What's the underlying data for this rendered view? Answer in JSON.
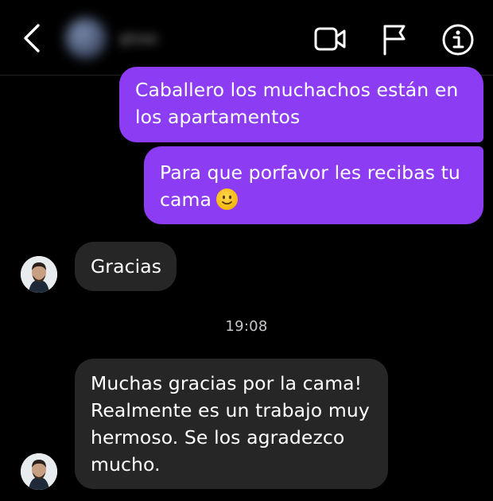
{
  "header": {
    "back_icon": "chevron-left-icon",
    "contact_name": "gtzas",
    "actions": [
      "video-call-icon",
      "flag-icon",
      "info-icon"
    ]
  },
  "messages": [
    {
      "direction": "outgoing",
      "text": "Caballero los muchachos están en los apartamentos"
    },
    {
      "direction": "outgoing",
      "text": "Para que porfavor les recibas tu cama",
      "emoji": "slightly-smiling-face"
    },
    {
      "direction": "incoming",
      "text": "Gracias"
    },
    {
      "direction": "incoming",
      "text": "Muchas gracias por la cama! Realmente es un trabajo muy hermoso. Se los agradezco mucho."
    }
  ],
  "timestamp": "19:08",
  "colors": {
    "outgoing_bubble": "#8c3df3",
    "incoming_bubble": "#262626",
    "background": "#000000"
  }
}
